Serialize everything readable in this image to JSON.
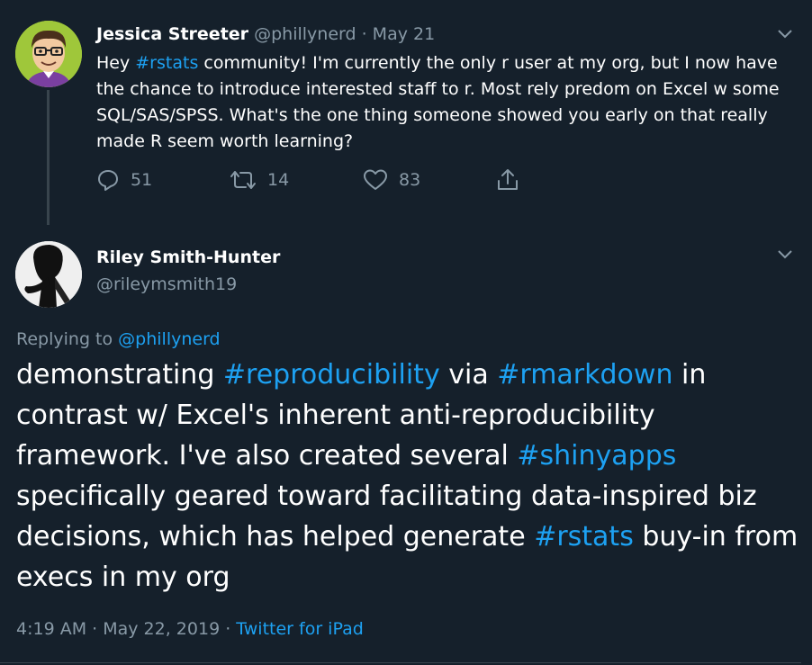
{
  "parent_tweet": {
    "author_name": "Jessica Streeter",
    "handle": "@phillynerd",
    "separator": " · ",
    "date": "May 21",
    "text_before": "Hey ",
    "hashtag": "#rstats",
    "text_after": " community! I'm currently the only r user at my org, but I now have the chance to introduce interested staff to r. Most rely predom on Excel w some SQL/SAS/SPSS.  What's the one thing someone showed you early on that really made R seem worth learning?",
    "replies_count": "51",
    "retweets_count": "14",
    "likes_count": "83",
    "icons": [
      "reply-icon",
      "retweet-icon",
      "like-icon",
      "share-icon",
      "chevron-down-icon"
    ]
  },
  "reply_tweet": {
    "author_name": "Riley Smith-Hunter",
    "handle": "@rileymsmith19",
    "replying_prefix": "Replying to ",
    "replying_to": "@phillynerd",
    "text": {
      "t1": "demonstrating ",
      "h1": "#reproducibility",
      "t2": " via ",
      "h2": "#rmarkdown",
      "t3": " in contrast w/ Excel's inherent anti-reproducibility framework. I've also created several ",
      "h3": "#shinyapps",
      "t4": " specifically geared toward facilitating data-inspired biz decisions, which has helped generate ",
      "h4": "#rstats",
      "t5": " buy-in from execs in my org"
    },
    "time": "4:19 AM",
    "sep1": " · ",
    "date": "May 22, 2019",
    "sep2": " · ",
    "source": "Twitter for iPad"
  },
  "colors": {
    "background": "#15202b",
    "link": "#1da1f2",
    "muted": "#8899a6",
    "divider": "#38444d"
  }
}
